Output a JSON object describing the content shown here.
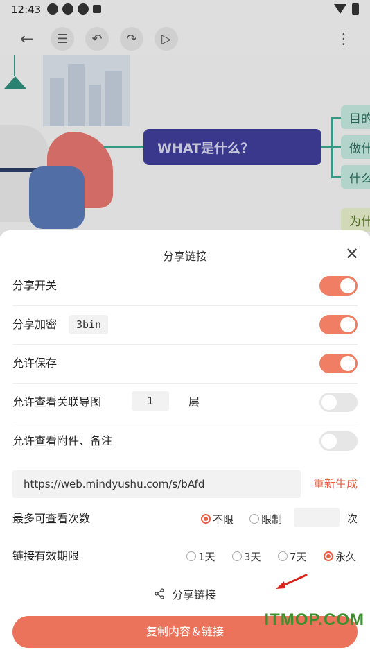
{
  "status_bar": {
    "time": "12:43"
  },
  "canvas": {
    "central_topic": "WHAT是什么？",
    "nodes": [
      "目的",
      "做什",
      "什么",
      "为什"
    ]
  },
  "sheet": {
    "title": "分享链接",
    "rows": [
      {
        "label": "分享开关",
        "toggle": "on"
      },
      {
        "label": "分享加密",
        "password": "3bin",
        "toggle": "on"
      },
      {
        "label": "允许保存",
        "toggle": "on"
      },
      {
        "label": "允许查看关联导图",
        "layers": "1",
        "unit": "层",
        "toggle": "off"
      },
      {
        "label": "允许查看附件、备注",
        "toggle": "off"
      }
    ],
    "url": "https://web.mindyushu.com/s/bAfd",
    "regenerate": "重新生成",
    "view_limit": {
      "label": "最多可查看次数",
      "options": [
        "不限",
        "限制"
      ],
      "selected": "不限",
      "unit": "次"
    },
    "validity": {
      "label": "链接有效期限",
      "options": [
        "1天",
        "3天",
        "7天",
        "永久"
      ],
      "selected": "永久"
    },
    "share_link_label": "分享链接",
    "copy_button": "复制内容＆链接"
  },
  "watermark": "ITMOP.COM",
  "colors": {
    "accent": "#ec735b",
    "toggle_off": "#e6e6e6",
    "topic": "#3f3d99"
  }
}
